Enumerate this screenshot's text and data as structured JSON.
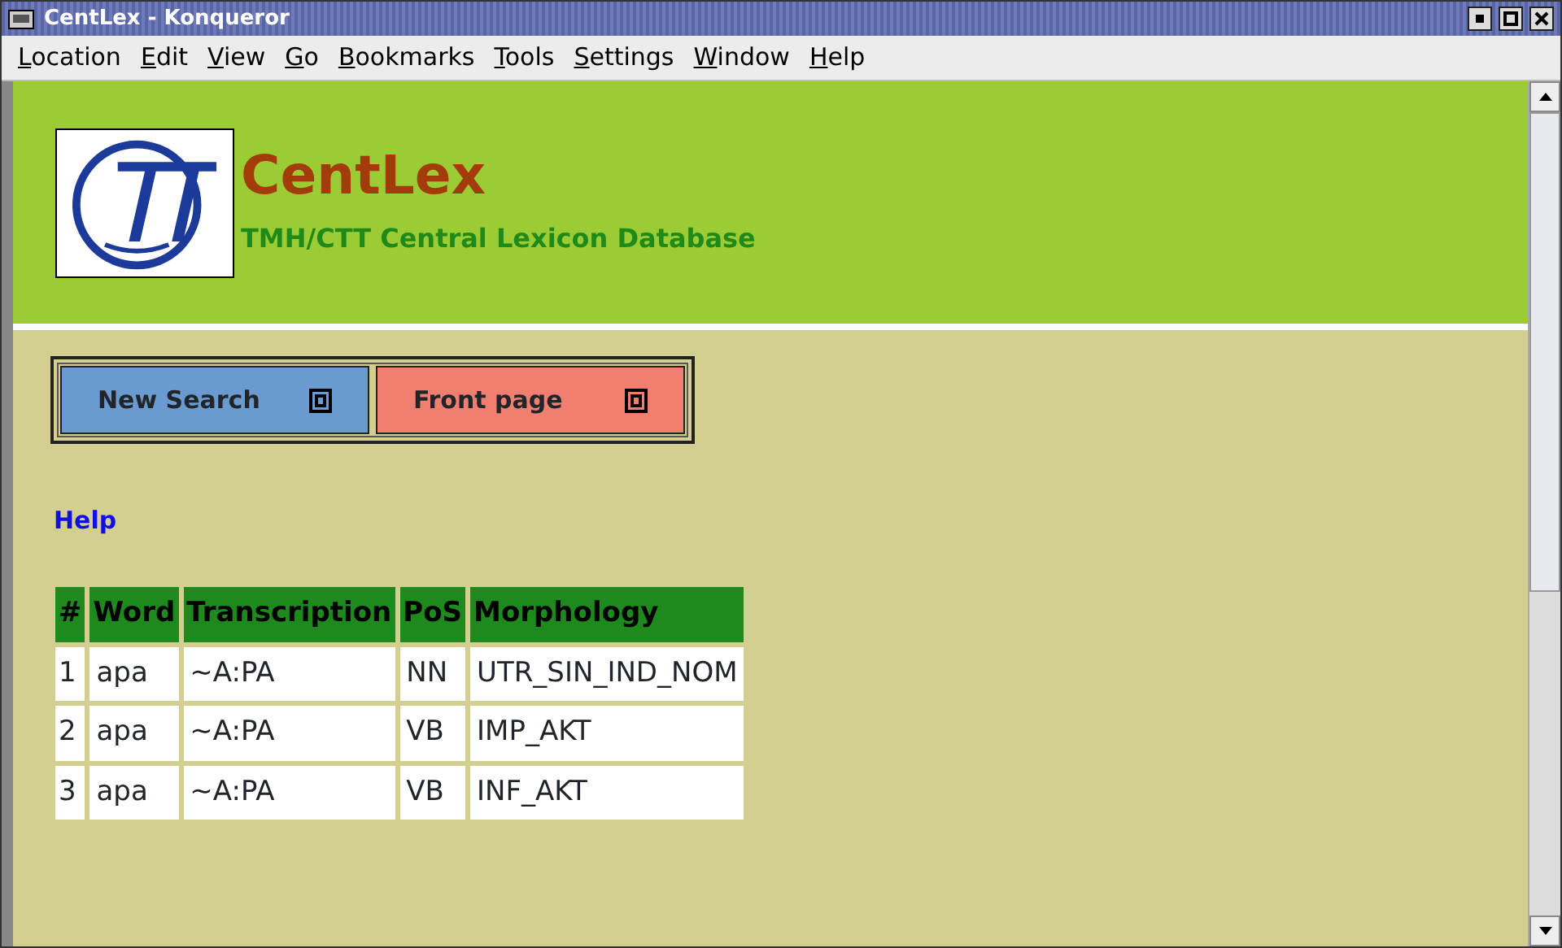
{
  "window": {
    "title": "CentLex - Konqueror"
  },
  "menu": [
    "Location",
    "Edit",
    "View",
    "Go",
    "Bookmarks",
    "Tools",
    "Settings",
    "Window",
    "Help"
  ],
  "header": {
    "title": "CentLex",
    "subtitle": "TMH/CTT Central Lexicon Database"
  },
  "nav_buttons": [
    {
      "label": "New Search",
      "color": "#6a9bd0"
    },
    {
      "label": "Front page",
      "color": "#f07f6f"
    }
  ],
  "help_link": "Help",
  "table": {
    "columns": [
      "#",
      "Word",
      "Transcription",
      "PoS",
      "Morphology"
    ],
    "rows": [
      [
        "1",
        "apa",
        "~A:PA",
        "NN",
        "UTR_SIN_IND_NOM"
      ],
      [
        "2",
        "apa",
        "~A:PA",
        "VB",
        "IMP_AKT"
      ],
      [
        "3",
        "apa",
        "~A:PA",
        "VB",
        "INF_AKT"
      ]
    ]
  }
}
